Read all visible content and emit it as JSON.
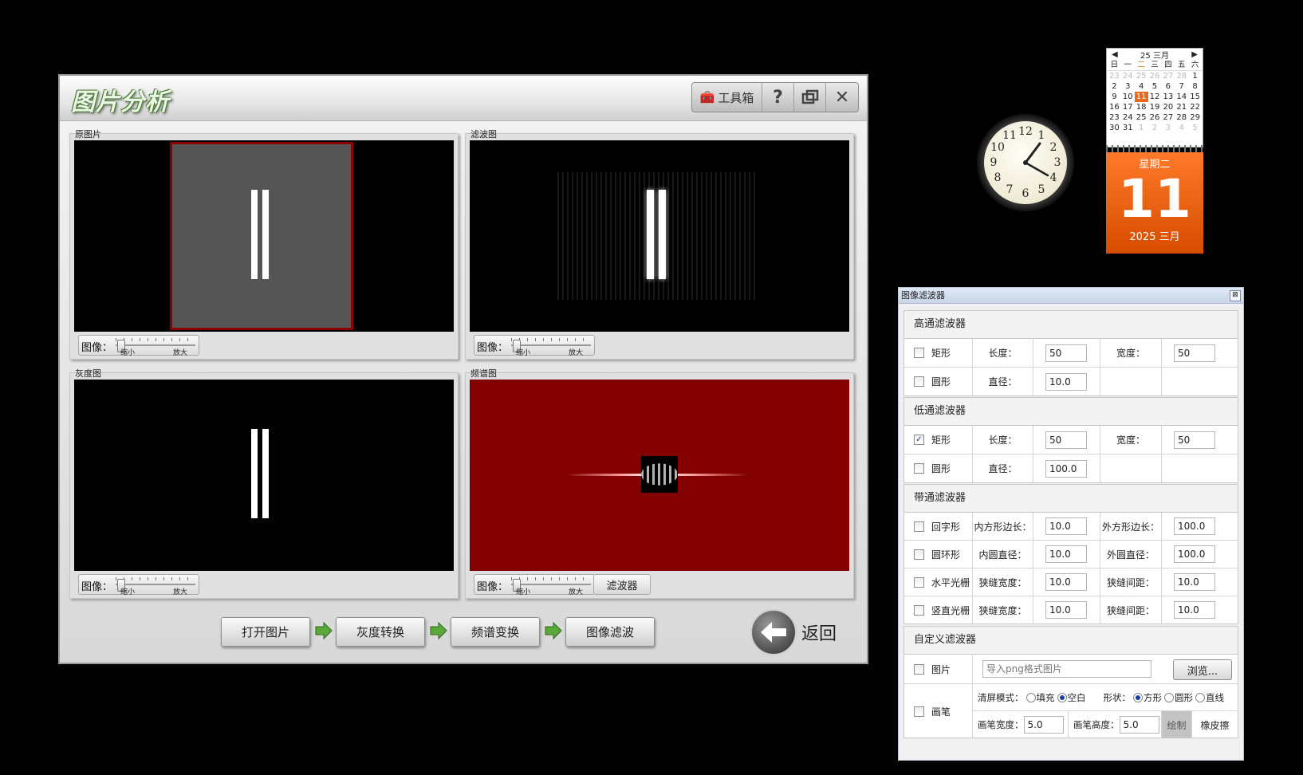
{
  "main": {
    "title": "图片分析",
    "toolbar": {
      "toolbox_label": "工具箱",
      "help_label": "?",
      "restore_label": "▢",
      "close_label": "✕"
    },
    "panels": {
      "original": {
        "label": "原图片"
      },
      "filtered": {
        "label": "滤波图"
      },
      "gray": {
        "label": "灰度图"
      },
      "spectrum": {
        "label": "频谱图"
      }
    },
    "slider": {
      "label": "图像：",
      "min_label": "缩小",
      "max_label": "放大"
    },
    "filter_button": "滤波器",
    "steps": [
      "打开图片",
      "灰度转换",
      "频谱变换",
      "图像滤波"
    ],
    "back_label": "返回",
    "colors": {
      "accent_green": "#5aa83a",
      "spectrum_bg": "#820000",
      "frame_red": "#8b0000"
    }
  },
  "clock": {
    "numbers": [
      "12",
      "1",
      "2",
      "3",
      "4",
      "5",
      "6",
      "7",
      "8",
      "9",
      "10",
      "11"
    ]
  },
  "calendar": {
    "header": "25 三月",
    "weekdays": [
      "日",
      "一",
      "二",
      "三",
      "四",
      "五",
      "六"
    ],
    "days": [
      [
        "23",
        "24",
        "25",
        "26",
        "27",
        "28",
        "1"
      ],
      [
        "2",
        "3",
        "4",
        "5",
        "6",
        "7",
        "8"
      ],
      [
        "9",
        "10",
        "11",
        "12",
        "13",
        "14",
        "15"
      ],
      [
        "16",
        "17",
        "18",
        "19",
        "20",
        "21",
        "22"
      ],
      [
        "23",
        "24",
        "25",
        "26",
        "27",
        "28",
        "29"
      ],
      [
        "30",
        "31",
        "1",
        "2",
        "3",
        "4",
        "5"
      ]
    ],
    "weekday_label": "星期二",
    "date": "11",
    "year_month": "2025 三月",
    "color": "#e56a1b"
  },
  "filter_window": {
    "title": "图像滤波器",
    "close_label": "⊠",
    "highpass": {
      "title": "高通滤波器",
      "rect_label": "矩形",
      "length_label": "长度：",
      "length": "50",
      "width_label": "宽度：",
      "width": "50",
      "circle_label": "圆形",
      "diameter_label": "直径：",
      "diameter": "10.0"
    },
    "lowpass": {
      "title": "低通滤波器",
      "rect_label": "矩形",
      "length_label": "长度：",
      "length": "50",
      "width_label": "宽度：",
      "width": "50",
      "circle_label": "圆形",
      "diameter_label": "直径：",
      "diameter": "100.0"
    },
    "bandpass": {
      "title": "带通滤波器",
      "rows": [
        {
          "name": "回字形",
          "l1": "内方形边长：",
          "v1": "10.0",
          "l2": "外方形边长：",
          "v2": "100.0"
        },
        {
          "name": "圆环形",
          "l1": "内圆直径：",
          "v1": "10.0",
          "l2": "外圆直径：",
          "v2": "100.0"
        },
        {
          "name": "水平光栅",
          "l1": "狭缝宽度：",
          "v1": "10.0",
          "l2": "狭缝间距：",
          "v2": "10.0"
        },
        {
          "name": "竖直光栅",
          "l1": "狭缝宽度：",
          "v1": "10.0",
          "l2": "狭缝间距：",
          "v2": "10.0"
        }
      ]
    },
    "custom": {
      "title": "自定义滤波器",
      "image_label": "图片",
      "image_placeholder": "导入png格式图片",
      "browse_label": "浏览...",
      "brush_label": "画笔",
      "clear_mode_label": "清屏模式：",
      "fill_label": "填充",
      "blank_label": "空白",
      "shape_label": "形状：",
      "square_label": "方形",
      "round_label": "圆形",
      "line_label": "直线",
      "brush_width_label": "画笔宽度：",
      "brush_width": "5.0",
      "brush_height_label": "画笔高度：",
      "brush_height": "5.0",
      "draw_label": "绘制",
      "erase_label": "橡皮擦"
    }
  }
}
